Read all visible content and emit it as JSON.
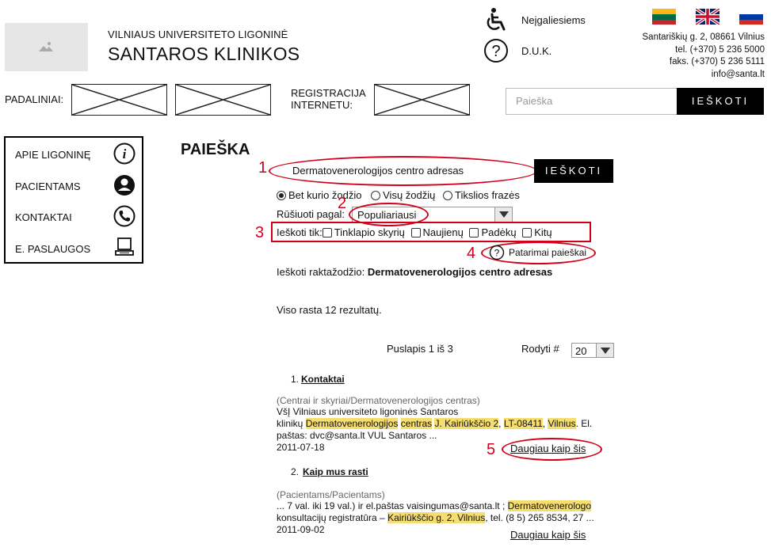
{
  "header": {
    "org_subtitle": "VILNIAUS UNIVERSITETO LIGONINĖ",
    "org_name": "SANTAROS KLINIKOS",
    "accessibility_label": "Neįgaliesiems",
    "faq_label": "D.U.K.",
    "address": {
      "street": "Santariškių g. 2, 08661 Vilnius",
      "tel": "tel. (+370) 5 236 5000",
      "fax": "faks. (+370) 5 236 5111",
      "email": "info@santa.lt"
    },
    "languages": [
      "lithuanian-flag",
      "uk-flag",
      "russian-flag"
    ]
  },
  "nav": {
    "divisions_label": "PADALINIAI:",
    "registration_label_1": "REGISTRACIJA",
    "registration_label_2": "INTERNETU:",
    "search_placeholder": "Paieška",
    "search_button": "IEŠKOTI"
  },
  "sidebar": {
    "items": [
      {
        "label": "APIE LIGONINĘ",
        "icon": "info-icon"
      },
      {
        "label": "PACIENTAMS",
        "icon": "user-icon"
      },
      {
        "label": "KONTAKTAI",
        "icon": "phone-icon"
      },
      {
        "label": "E. PASLAUGOS",
        "icon": "computer-icon"
      }
    ]
  },
  "search": {
    "page_title": "PAIEŠKA",
    "query": "Dermatovenerologijos centro adresas",
    "button": "IEŠKOTI",
    "modes": [
      "Bet kurio žodžio",
      "Visų žodžių",
      "Tikslios frazės"
    ],
    "sort_label": "Rūšiuoti pagal:",
    "sort_value": "Populiariausi",
    "filter_label": "Ieškoti tik:",
    "filters": [
      "Tinklapio skyrių",
      "Naujienų",
      "Padėkų",
      "Kitų"
    ],
    "tips_label": "Patarimai paieškai",
    "keyword_label": "Ieškoti raktažodžio:",
    "keyword_value": "Dermatovenerologijos centro adresas",
    "total": "Viso rasta 12 rezultatų.",
    "pagination": "Puslapis 1 iš 3",
    "show_label": "Rodyti #",
    "show_value": "20"
  },
  "annotations": [
    "1",
    "2",
    "3",
    "4",
    "5"
  ],
  "results": [
    {
      "num": "1.",
      "title": "Kontaktai",
      "path": "(Centrai ir skyriai/Dermatovenerologijos centras)",
      "line1": "VšĮ Vilniaus universiteto ligoninės Santaros",
      "l2_a": "klinikų ",
      "l2_h1": "Dermatovenerologijos",
      "l2_b": " ",
      "l2_h2": "centras",
      "l2_c": " ",
      "l2_h3": "J. Kairiūkščio 2",
      "l2_d": ", ",
      "l2_h4": "LT-08411",
      "l2_e": ", ",
      "l2_h5": "Vilnius",
      "l2_f": ". El.",
      "line3": "paštas: dvc@santa.lt VUL Santaros ...",
      "date": "2011-07-18",
      "more": "Daugiau kaip šis"
    },
    {
      "num": "2.",
      "title": "Kaip mus rasti",
      "path": "(Pacientams/Pacientams)",
      "l1_a": "... 7 val. iki 19 val.) ir el.paštas vaisingumas@santa.lt ; ",
      "l1_h1": "Dermatovenerologo",
      "l2_a": "konsultacijų registratūra – ",
      "l2_h1": "Kairiūkščio g. 2, Vilnius",
      "l2_b": ", tel. (8 5) 265 8534, 27 ...",
      "date": "2011-09-02",
      "more": "Daugiau kaip šis"
    }
  ]
}
